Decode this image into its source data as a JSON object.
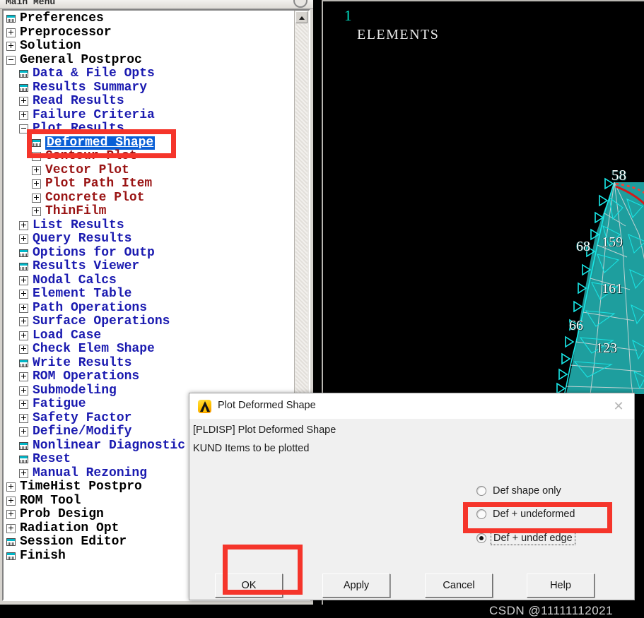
{
  "app": {
    "menu_window_title": "Main Menu"
  },
  "tree": {
    "items": [
      {
        "label": "Preferences",
        "level": 0,
        "icon": "dialog-icon",
        "color": "black"
      },
      {
        "label": "Preprocessor",
        "level": 0,
        "icon": "expand-plus",
        "color": "black"
      },
      {
        "label": "Solution",
        "level": 0,
        "icon": "expand-plus",
        "color": "black"
      },
      {
        "label": "General Postproc",
        "level": 0,
        "icon": "expand-minus",
        "color": "black"
      },
      {
        "label": "Data & File Opts",
        "level": 1,
        "icon": "dialog-icon",
        "color": "blue"
      },
      {
        "label": "Results Summary",
        "level": 1,
        "icon": "dialog-icon",
        "color": "blue"
      },
      {
        "label": "Read Results",
        "level": 1,
        "icon": "expand-plus",
        "color": "blue"
      },
      {
        "label": "Failure Criteria",
        "level": 1,
        "icon": "expand-plus",
        "color": "blue"
      },
      {
        "label": "Plot Results",
        "level": 1,
        "icon": "expand-minus",
        "color": "blue"
      },
      {
        "label": "Deformed Shape",
        "level": 2,
        "icon": "dialog-icon",
        "color": "blue",
        "selected": true
      },
      {
        "label": "Contour Plot",
        "level": 2,
        "icon": "expand-minus",
        "color": "maroon"
      },
      {
        "label": "Vector Plot",
        "level": 2,
        "icon": "expand-plus",
        "color": "maroon"
      },
      {
        "label": "Plot Path Item",
        "level": 2,
        "icon": "expand-plus",
        "color": "maroon"
      },
      {
        "label": "Concrete Plot",
        "level": 2,
        "icon": "expand-plus",
        "color": "maroon"
      },
      {
        "label": "ThinFilm",
        "level": 2,
        "icon": "expand-plus",
        "color": "maroon"
      },
      {
        "label": "List Results",
        "level": 1,
        "icon": "expand-plus",
        "color": "blue"
      },
      {
        "label": "Query Results",
        "level": 1,
        "icon": "expand-plus",
        "color": "blue"
      },
      {
        "label": "Options for Outp",
        "level": 1,
        "icon": "dialog-icon",
        "color": "blue"
      },
      {
        "label": "Results Viewer",
        "level": 1,
        "icon": "dialog-icon",
        "color": "blue"
      },
      {
        "label": "Nodal Calcs",
        "level": 1,
        "icon": "expand-plus",
        "color": "blue"
      },
      {
        "label": "Element Table",
        "level": 1,
        "icon": "expand-plus",
        "color": "blue"
      },
      {
        "label": "Path Operations",
        "level": 1,
        "icon": "expand-plus",
        "color": "blue"
      },
      {
        "label": "Surface Operations",
        "level": 1,
        "icon": "expand-plus",
        "color": "blue"
      },
      {
        "label": "Load Case",
        "level": 1,
        "icon": "expand-plus",
        "color": "blue"
      },
      {
        "label": "Check Elem Shape",
        "level": 1,
        "icon": "expand-plus",
        "color": "blue"
      },
      {
        "label": "Write Results",
        "level": 1,
        "icon": "dialog-icon",
        "color": "blue"
      },
      {
        "label": "ROM Operations",
        "level": 1,
        "icon": "expand-plus",
        "color": "blue"
      },
      {
        "label": "Submodeling",
        "level": 1,
        "icon": "expand-plus",
        "color": "blue"
      },
      {
        "label": "Fatigue",
        "level": 1,
        "icon": "expand-plus",
        "color": "blue"
      },
      {
        "label": "Safety Factor",
        "level": 1,
        "icon": "expand-plus",
        "color": "blue"
      },
      {
        "label": "Define/Modify",
        "level": 1,
        "icon": "expand-plus",
        "color": "blue"
      },
      {
        "label": "Nonlinear Diagnostic",
        "level": 1,
        "icon": "dialog-icon",
        "color": "blue"
      },
      {
        "label": "Reset",
        "level": 1,
        "icon": "dialog-icon",
        "color": "blue"
      },
      {
        "label": "Manual Rezoning",
        "level": 1,
        "icon": "expand-plus",
        "color": "blue"
      },
      {
        "label": "TimeHist Postpro",
        "level": 0,
        "icon": "expand-plus",
        "color": "black"
      },
      {
        "label": "ROM Tool",
        "level": 0,
        "icon": "expand-plus",
        "color": "black"
      },
      {
        "label": "Prob Design",
        "level": 0,
        "icon": "expand-plus",
        "color": "black"
      },
      {
        "label": "Radiation Opt",
        "level": 0,
        "icon": "expand-plus",
        "color": "black"
      },
      {
        "label": "Session Editor",
        "level": 0,
        "icon": "dialog-icon",
        "color": "black"
      },
      {
        "label": "Finish",
        "level": 0,
        "icon": "dialog-icon",
        "color": "black"
      }
    ]
  },
  "graphics": {
    "plot_number": "1",
    "plot_title": "ELEMENTS",
    "node_labels": [
      "58",
      "159",
      "68",
      "161",
      "66",
      "123"
    ],
    "mesh_color": "#19e6e6",
    "mesh_fill_color": "#1f9e9e",
    "highlight_curve_color": "#d41a1a",
    "background_color": "#000000"
  },
  "dialog": {
    "title": "Plot Deformed Shape",
    "close_label": "✕",
    "command_line": "[PLDISP]  Plot Deformed Shape",
    "param_line": "KUND    Items to be plotted",
    "radio_options": [
      {
        "label": "Def shape only",
        "selected": false
      },
      {
        "label": "Def + undeformed",
        "selected": false
      },
      {
        "label": "Def + undef edge",
        "selected": true
      }
    ],
    "buttons": {
      "ok": "OK",
      "apply": "Apply",
      "cancel": "Cancel",
      "help": "Help"
    }
  },
  "watermark": {
    "text": "CSDN @11111112021"
  },
  "annotations": {
    "color": "#f5352b",
    "targets": [
      "deformed-shape-tree-item",
      "def-undef-edge-radio",
      "ok-button"
    ]
  }
}
